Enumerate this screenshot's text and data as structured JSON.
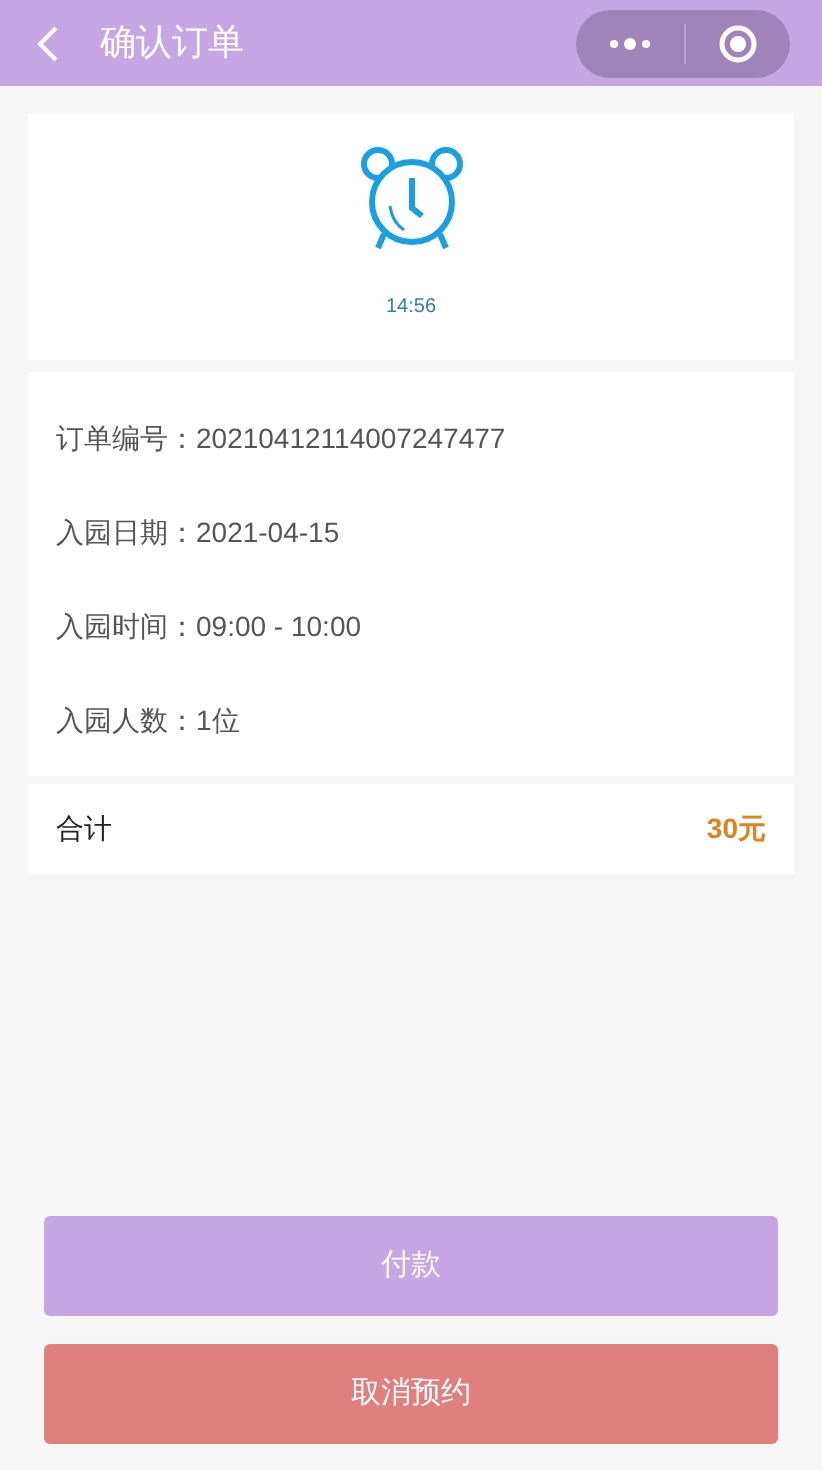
{
  "header": {
    "title": "确认订单"
  },
  "timer": {
    "time": "14:56"
  },
  "details": [
    {
      "label": "订单编号：",
      "value": "20210412114007247477"
    },
    {
      "label": "入园日期：",
      "value": "2021-04-15"
    },
    {
      "label": "入园时间：",
      "value": "09:00 - 10:00"
    },
    {
      "label": "入园人数：",
      "value": "1位"
    }
  ],
  "total": {
    "label": "合计",
    "amount": "30元"
  },
  "buttons": [
    {
      "label": "付款",
      "kind": "primary"
    },
    {
      "label": "取消预约",
      "kind": "danger"
    }
  ]
}
